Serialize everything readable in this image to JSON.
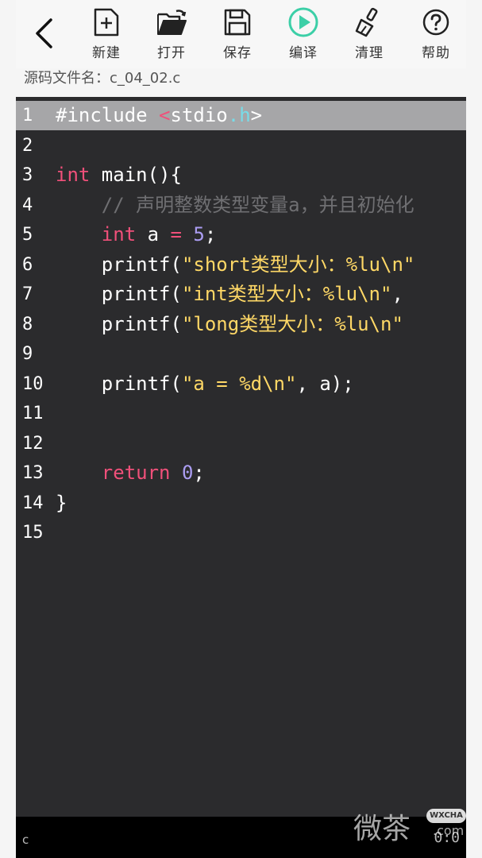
{
  "toolbar": {
    "items": [
      {
        "label": "新建",
        "icon": "new-file-icon"
      },
      {
        "label": "打开",
        "icon": "open-folder-icon"
      },
      {
        "label": "保存",
        "icon": "save-icon"
      },
      {
        "label": "编译",
        "icon": "compile-play-icon"
      },
      {
        "label": "清理",
        "icon": "broom-icon"
      },
      {
        "label": "帮助",
        "icon": "help-icon"
      }
    ],
    "accent_color": "#3ccfa7"
  },
  "filename": {
    "label": "源码文件名：",
    "value": "c_04_02.c"
  },
  "editor": {
    "lines": [
      {
        "number": "1",
        "tokens": [
          {
            "t": "#include ",
            "c": "plain"
          },
          {
            "t": "<",
            "c": "ang"
          },
          {
            "t": "stdio",
            "c": "plain"
          },
          {
            "t": ".",
            "c": "dot"
          },
          {
            "t": "h",
            "c": "dot"
          },
          {
            "t": ">",
            "c": "plain"
          }
        ],
        "highlighted": true
      },
      {
        "number": "2",
        "tokens": []
      },
      {
        "number": "3",
        "tokens": [
          {
            "t": "int",
            "c": "kw"
          },
          {
            "t": " main(){",
            "c": "plain"
          }
        ]
      },
      {
        "number": "4",
        "tokens": [
          {
            "t": "    // 声明整数类型变量a，并且初始化",
            "c": "cmt"
          }
        ]
      },
      {
        "number": "5",
        "tokens": [
          {
            "t": "    ",
            "c": "plain"
          },
          {
            "t": "int",
            "c": "kw"
          },
          {
            "t": " a ",
            "c": "plain"
          },
          {
            "t": "=",
            "c": "kw"
          },
          {
            "t": " ",
            "c": "plain"
          },
          {
            "t": "5",
            "c": "num"
          },
          {
            "t": ";",
            "c": "plain"
          }
        ]
      },
      {
        "number": "6",
        "tokens": [
          {
            "t": "    printf(",
            "c": "plain"
          },
          {
            "t": "\"short类型大小：%lu\\n\"",
            "c": "str"
          }
        ]
      },
      {
        "number": "7",
        "tokens": [
          {
            "t": "    printf(",
            "c": "plain"
          },
          {
            "t": "\"int类型大小：%lu\\n\"",
            "c": "str"
          },
          {
            "t": ", ",
            "c": "plain"
          }
        ]
      },
      {
        "number": "8",
        "tokens": [
          {
            "t": "    printf(",
            "c": "plain"
          },
          {
            "t": "\"long类型大小：%lu\\n\"",
            "c": "str"
          }
        ]
      },
      {
        "number": "9",
        "tokens": []
      },
      {
        "number": "10",
        "tokens": [
          {
            "t": "    printf(",
            "c": "plain"
          },
          {
            "t": "\"a = %d\\n\"",
            "c": "str"
          },
          {
            "t": ", a);",
            "c": "plain"
          }
        ]
      },
      {
        "number": "11",
        "tokens": []
      },
      {
        "number": "12",
        "tokens": []
      },
      {
        "number": "13",
        "tokens": [
          {
            "t": "    ",
            "c": "plain"
          },
          {
            "t": "return",
            "c": "kw"
          },
          {
            "t": " ",
            "c": "plain"
          },
          {
            "t": "0",
            "c": "num"
          },
          {
            "t": ";",
            "c": "plain"
          }
        ]
      },
      {
        "number": "14",
        "tokens": [
          {
            "t": "}",
            "c": "plain"
          }
        ]
      },
      {
        "number": "15",
        "tokens": []
      }
    ]
  },
  "status": {
    "language": "c",
    "cursor": "0:0"
  },
  "watermark": {
    "text": "微茶",
    "badge": "WXCHA",
    "suffix": ".com"
  }
}
